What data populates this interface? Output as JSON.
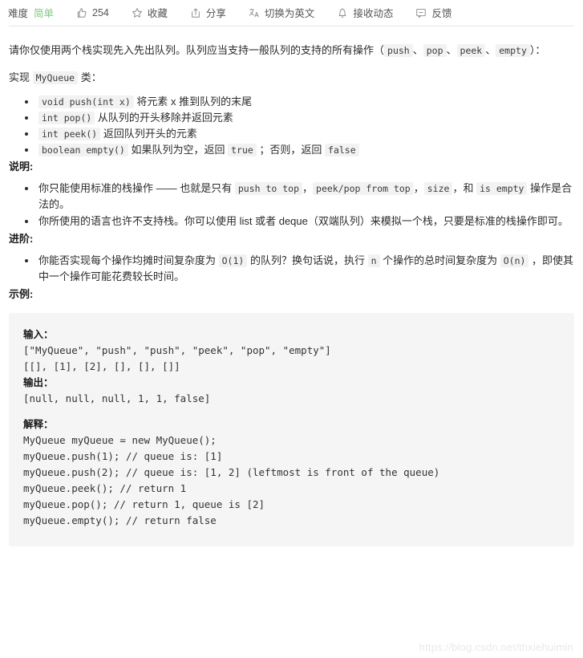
{
  "toolbar": {
    "difficulty_label": "难度",
    "difficulty_value": "简单",
    "difficulty_color": "#7fc97f",
    "items": [
      {
        "icon": "thumbs-up-icon",
        "label": "254",
        "name": "likes-button"
      },
      {
        "icon": "star-icon",
        "label": "收藏",
        "name": "favorite-button"
      },
      {
        "icon": "share-icon",
        "label": "分享",
        "name": "share-button"
      },
      {
        "icon": "translate-icon",
        "label": "切换为英文",
        "name": "switch-language-button"
      },
      {
        "icon": "bell-icon",
        "label": "接收动态",
        "name": "subscribe-button"
      },
      {
        "icon": "feedback-icon",
        "label": "反馈",
        "name": "feedback-button"
      }
    ]
  },
  "problem": {
    "intro_1": "请你仅使用两个栈实现先入先出队列。队列应当支持一般队列的支持的所有操作（",
    "intro_code_1": "push",
    "intro_sep_1": "、",
    "intro_code_2": "pop",
    "intro_sep_2": "、",
    "intro_code_3": "peek",
    "intro_sep_3": "、",
    "intro_code_4": "empty",
    "intro_2": "）：",
    "implement_pre": "实现 ",
    "implement_code": "MyQueue",
    "implement_post": " 类：",
    "methods": [
      {
        "code": "void push(int x)",
        "text": " 将元素 x 推到队列的末尾"
      },
      {
        "code": "int pop()",
        "text": " 从队列的开头移除并返回元素"
      },
      {
        "code": "int peek()",
        "text": " 返回队列开头的元素"
      },
      {
        "code": "boolean empty()",
        "text_before": " 如果队列为空，返回 ",
        "code2": "true",
        "text_mid": " ；否则，返回 ",
        "code3": "false"
      }
    ]
  },
  "notes": {
    "title": "说明:",
    "item1_a": "你只能使用标准的栈操作 —— 也就是只有 ",
    "item1_c1": "push to top",
    "item1_b": "，",
    "item1_c2": "peek/pop from top",
    "item1_c": "，",
    "item1_c3": "size",
    "item1_d": "，和 ",
    "item1_c4": "is empty",
    "item1_e": " 操作是合法的。",
    "item2": "你所使用的语言也许不支持栈。你可以使用 list 或者 deque（双端队列）来模拟一个栈，只要是标准的栈操作即可。"
  },
  "advanced": {
    "title": "进阶:",
    "item1_a": "你能否实现每个操作均摊时间复杂度为 ",
    "item1_c1": "O(1)",
    "item1_b": " 的队列？换句话说，执行 ",
    "item1_c2": "n",
    "item1_c": " 个操作的总时间复杂度为 ",
    "item1_c3": "O(n)",
    "item1_d": " ，即使其中一个操作可能花费较长时间。"
  },
  "example": {
    "title": "示例:",
    "input_label": "输入：",
    "input_lines": [
      "[\"MyQueue\", \"push\", \"push\", \"peek\", \"pop\", \"empty\"]",
      "[[], [1], [2], [], [], []]"
    ],
    "output_label": "输出：",
    "output_lines": [
      "[null, null, null, 1, 1, false]"
    ],
    "explain_label": "解释：",
    "explain_lines": [
      "MyQueue myQueue = new MyQueue();",
      "myQueue.push(1); // queue is: [1]",
      "myQueue.push(2); // queue is: [1, 2] (leftmost is front of the queue)",
      "myQueue.peek(); // return 1",
      "myQueue.pop(); // return 1, queue is [2]",
      "myQueue.empty(); // return false"
    ]
  },
  "watermark": "https://blog.csdn.net/thxiehuimin"
}
